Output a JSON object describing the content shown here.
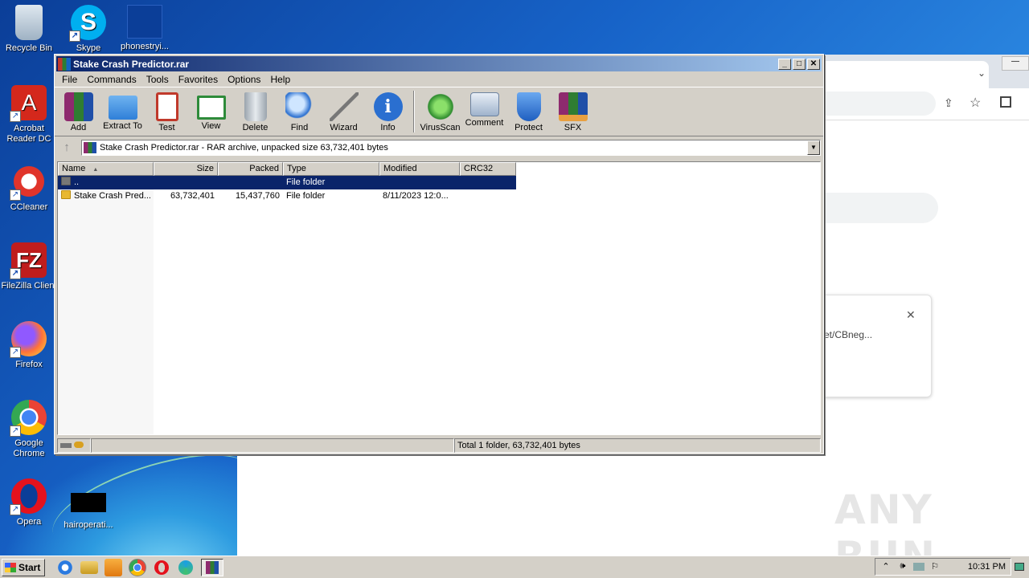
{
  "desktop": {
    "icons": [
      {
        "label": "Recycle Bin",
        "icon": "recycle-bin-icon"
      },
      {
        "label": "Skype",
        "icon": "skype-icon"
      },
      {
        "label": "phonestryi...",
        "icon": "file-icon"
      },
      {
        "label": "Acrobat Reader DC",
        "icon": "acrobat-icon"
      },
      {
        "label": "CCleaner",
        "icon": "ccleaner-icon"
      },
      {
        "label": "FileZilla Client",
        "icon": "filezilla-icon"
      },
      {
        "label": "Firefox",
        "icon": "firefox-icon"
      },
      {
        "label": "Google Chrome",
        "icon": "chrome-icon"
      },
      {
        "label": "Opera",
        "icon": "opera-icon"
      },
      {
        "label": "hairoperati...",
        "icon": "file-icon"
      }
    ]
  },
  "chrome_bg": {
    "card_text": "et/CBneg...",
    "close_glyph": "✕"
  },
  "winrar": {
    "title": "Stake Crash Predictor.rar",
    "menu": [
      "File",
      "Commands",
      "Tools",
      "Favorites",
      "Options",
      "Help"
    ],
    "toolbar": [
      "Add",
      "Extract To",
      "Test",
      "View",
      "Delete",
      "Find",
      "Wizard",
      "Info",
      "VirusScan",
      "Comment",
      "Protect",
      "SFX"
    ],
    "address": "Stake Crash Predictor.rar - RAR archive, unpacked size 63,732,401 bytes",
    "columns": [
      "Name",
      "Size",
      "Packed",
      "Type",
      "Modified",
      "CRC32"
    ],
    "rows": [
      {
        "name": "..",
        "size": "",
        "packed": "",
        "type": "File folder",
        "modified": "",
        "crc": ""
      },
      {
        "name": "Stake Crash Pred...",
        "size": "63,732,401",
        "packed": "15,437,760",
        "type": "File folder",
        "modified": "8/11/2023 12:0...",
        "crc": ""
      }
    ],
    "status": "Total 1 folder, 63,732,401 bytes"
  },
  "taskbar": {
    "start_label": "Start",
    "clock": "10:31 PM"
  },
  "watermark": "ANY RUN"
}
